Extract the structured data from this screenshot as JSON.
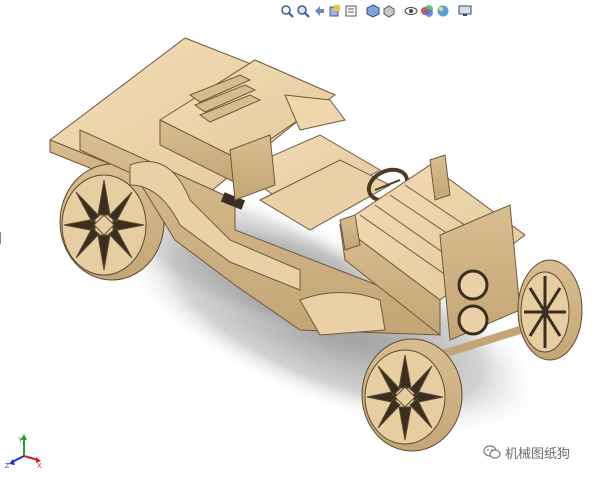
{
  "toolbar": {
    "icons": [
      "zoom-to-fit-icon",
      "zoom-area-icon",
      "previous-view-icon",
      "section-view-icon",
      "dynamic-annotation-icon",
      "view-orientation-icon",
      "display-style-icon",
      "hide-show-items-icon",
      "edit-appearance-icon",
      "apply-scene-icon",
      "view-settings-icon"
    ]
  },
  "triad": {
    "x_label": "X",
    "y_label": "Y",
    "z_label": "Z",
    "x_color": "#d02020",
    "y_color": "#20a020",
    "z_color": "#2030d0"
  },
  "watermark": {
    "text": "机械图纸狗",
    "icon": "wechat-icon"
  },
  "model": {
    "material_color": "#e8cfa6",
    "shadow_color": "#8a8a8a"
  }
}
